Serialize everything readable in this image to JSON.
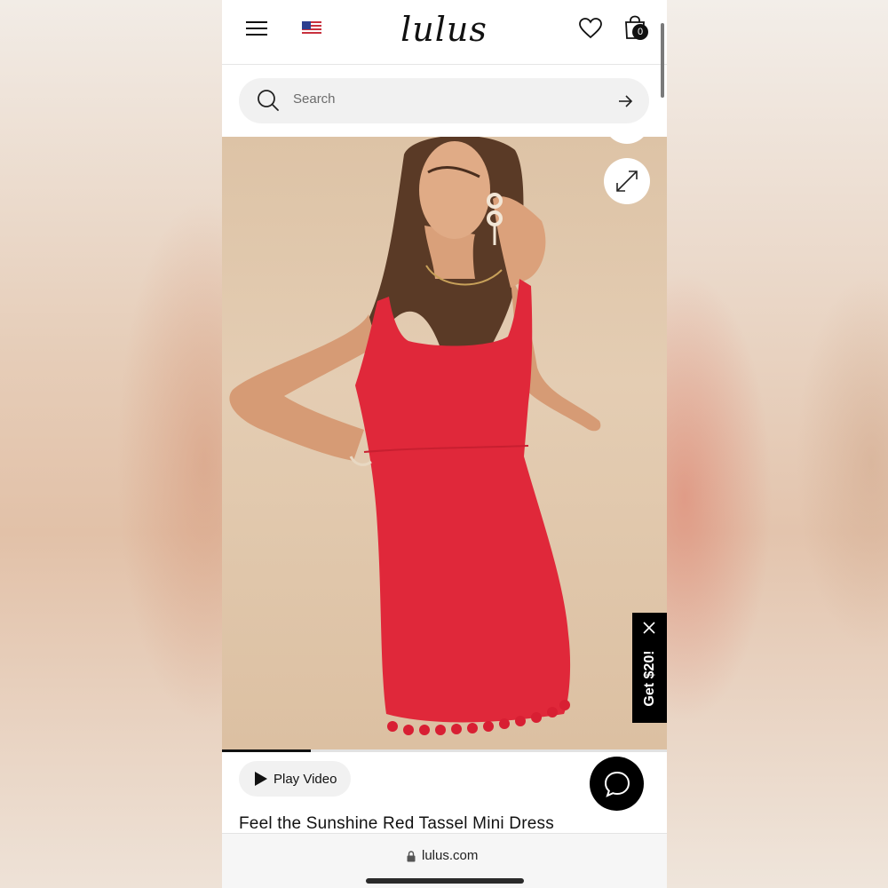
{
  "header": {
    "logo_text": "lulus",
    "menu_icon": "hamburger-menu-icon",
    "flag_icon": "us-flag-icon",
    "wishlist_icon": "heart-icon",
    "cart_icon": "shopping-bag-icon",
    "cart_count": "0"
  },
  "search": {
    "placeholder": "Search",
    "icon": "search-icon",
    "submit_icon": "arrow-right-icon"
  },
  "hero": {
    "expand_icon": "expand-icon",
    "progress": 0.2
  },
  "promo": {
    "label": "Get $20!",
    "close_icon": "close-icon"
  },
  "video": {
    "label": "Play Video",
    "icon": "play-icon"
  },
  "chat": {
    "icon": "chat-bubble-icon"
  },
  "product": {
    "title": "Feel the Sunshine Red Tassel Mini Dress"
  },
  "browser": {
    "url": "lulus.com",
    "lock_icon": "lock-icon"
  },
  "colors": {
    "accent": "#000000",
    "dress_red": "#e0283a",
    "search_bg": "#f1f1f1"
  }
}
